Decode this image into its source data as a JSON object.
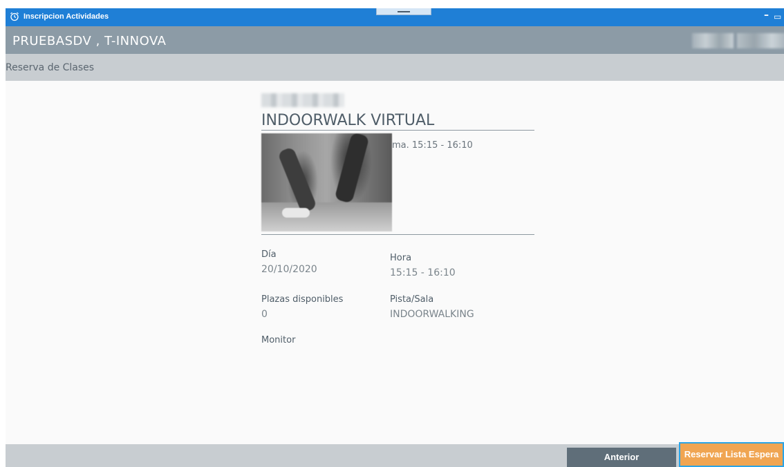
{
  "window": {
    "title": "Inscripcion Actividades",
    "minimize_glyph": "–",
    "restore_glyph": "▭",
    "close_glyph": "✕"
  },
  "user": {
    "name": "PRUEBASDV , T-INNOVA"
  },
  "section": {
    "title": "Reserva de Clases"
  },
  "activity": {
    "title": "INDOORWALK VIRTUAL",
    "schedule_short": "ma. 15:15 - 16:10",
    "image_icon": "activity-photo"
  },
  "details": {
    "day_label": "Día",
    "day_value": "20/10/2020",
    "time_label": "Hora",
    "time_value": "15:15 - 16:10",
    "places_label": "Plazas disponibles",
    "places_value": "0",
    "room_label": "Pista/Sala",
    "room_value": "INDOORWALKING",
    "monitor_label": "Monitor"
  },
  "footer": {
    "prev_label": "Anterior",
    "reserve_label": "Reservar Lista Espera"
  },
  "colors": {
    "titlebar": "#1f7fd6",
    "userbar": "#8c9ba6",
    "sectionbar": "#c8cdd1",
    "prev_button": "#5f6e79",
    "reserve_button": "#f0a552",
    "focus_border": "#2aa4e6"
  }
}
